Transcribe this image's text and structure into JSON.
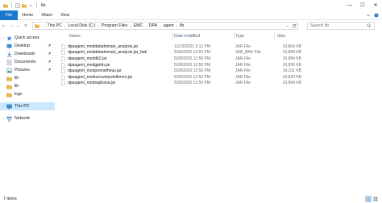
{
  "window": {
    "title": "lib",
    "controls": {
      "minimize": "—",
      "maximize": "☐",
      "close": "✕"
    }
  },
  "ribbon": {
    "tabs": [
      "File",
      "Home",
      "Share",
      "View"
    ],
    "expand_icon": "chevron-down-icon",
    "help_icon": "help-icon"
  },
  "address": {
    "breadcrumbs": [
      "This PC",
      "Local Disk (C:)",
      "Program Files",
      "EMC",
      "DPA",
      "agent",
      "lib"
    ],
    "search_placeholder": "Search lib"
  },
  "navigation": {
    "items": [
      {
        "label": "Quick access",
        "icon": "star-icon",
        "pinned": false
      },
      {
        "label": "Desktop",
        "icon": "desktop-icon",
        "pinned": true
      },
      {
        "label": "Downloads",
        "icon": "download-icon",
        "pinned": true
      },
      {
        "label": "Documents",
        "icon": "documents-icon",
        "pinned": true
      },
      {
        "label": "Pictures",
        "icon": "pictures-icon",
        "pinned": true
      },
      {
        "label": "lib",
        "icon": "folder-icon",
        "pinned": false
      },
      {
        "label": "lib",
        "icon": "folder-icon",
        "pinned": false
      },
      {
        "label": "logs",
        "icon": "folder-icon",
        "pinned": false
      },
      {
        "label": "This PC",
        "icon": "computer-icon",
        "pinned": false,
        "selected": true
      },
      {
        "label": "Network",
        "icon": "network-icon",
        "pinned": false
      }
    ]
  },
  "columns": {
    "name": "Name",
    "date": "Date modified",
    "type": "Type",
    "size": "Size"
  },
  "files": [
    {
      "name": "dpaagent_moddatadomain_analysis.jar",
      "date": "12/23/2021 3:12 PM",
      "type": "JAR File",
      "size": "10,864 KB"
    },
    {
      "name": "dpaagent_moddatadomain_analysis.jar_bak",
      "date": "5/28/2020 12:50 PM",
      "type": "JAR_BAK File",
      "size": "10,884 KB"
    },
    {
      "name": "dpaagent_moddb2.jar",
      "date": "5/28/2020 12:50 PM",
      "type": "JAR File",
      "size": "10,884 KB"
    },
    {
      "name": "dpaagent_modgpdm.jar",
      "date": "5/28/2020 12:50 PM",
      "type": "JAR File",
      "size": "10,836 KB"
    },
    {
      "name": "dpaagent_modprometheus.jar",
      "date": "5/28/2020 12:50 PM",
      "type": "JAR File",
      "size": "16,311 KB"
    },
    {
      "name": "dpaagent_modrecoverpointforvm.jar",
      "date": "5/28/2020 12:50 PM",
      "type": "JAR File",
      "size": "10,820 KB"
    },
    {
      "name": "dpaagent_modsaphana.jar",
      "date": "5/28/2020 12:50 PM",
      "type": "JAR File",
      "size": "10,864 KB"
    }
  ],
  "status": {
    "item_count": "7 items"
  },
  "colors": {
    "accent": "#1979ca",
    "selection": "#cce8ff",
    "folder": "#e8b84a",
    "header_text": "#4c607a"
  }
}
